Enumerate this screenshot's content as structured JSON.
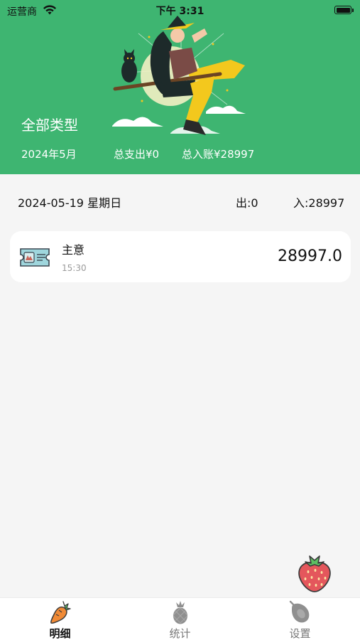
{
  "status_bar": {
    "carrier": "运营商",
    "time": "下午 3:31"
  },
  "header": {
    "filter_type": "全部类型",
    "month": "2024年5月",
    "month_expense": "总支出¥0",
    "month_income": "总入账¥28997"
  },
  "day": {
    "date": "2024-05-19 星期日",
    "expense": "出:0",
    "income": "入:28997"
  },
  "records": [
    {
      "icon": "ticket-icon",
      "category": "主意",
      "time": "15:30",
      "amount": "28997.0"
    }
  ],
  "fab": {
    "icon": "strawberry-icon"
  },
  "tabbar": {
    "tabs": [
      {
        "label": "明细",
        "icon": "carrot-icon",
        "active": true
      },
      {
        "label": "统计",
        "icon": "pineapple-icon",
        "active": false
      },
      {
        "label": "设置",
        "icon": "papaya-icon",
        "active": false
      }
    ]
  },
  "colors": {
    "brand_green": "#3eb571",
    "background": "#f5f5f5",
    "muted_text": "#9a9a9a"
  }
}
